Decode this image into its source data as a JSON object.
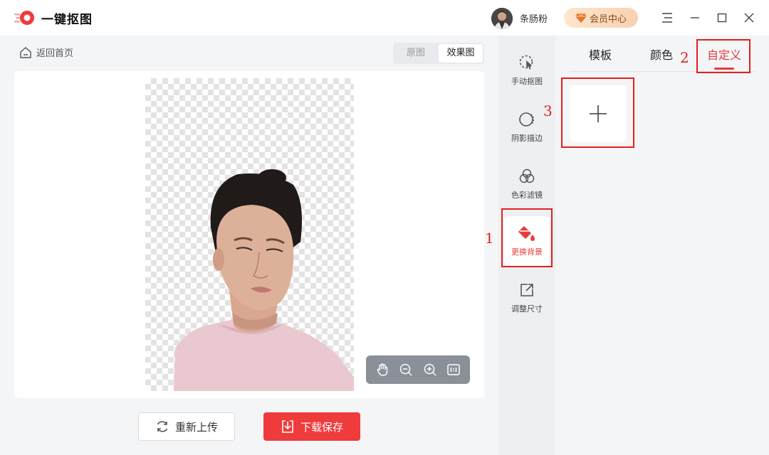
{
  "app": {
    "title": "一键抠图"
  },
  "user": {
    "name": "条肠粉"
  },
  "vip": {
    "label": "会员中心"
  },
  "nav": {
    "back_home": "返回首页"
  },
  "view_toggle": {
    "original": "原图",
    "effect": "效果图"
  },
  "tools": [
    {
      "label": "手动抠图",
      "icon": "cursor-select-icon"
    },
    {
      "label": "阴影描边",
      "icon": "shadow-outline-icon"
    },
    {
      "label": "色彩滤镜",
      "icon": "color-filter-icon"
    },
    {
      "label": "更换背景",
      "icon": "paint-bucket-icon",
      "active": true
    },
    {
      "label": "调整尺寸",
      "icon": "resize-icon"
    }
  ],
  "panel_tabs": {
    "template": "模板",
    "color": "颜色",
    "custom": "自定义"
  },
  "actions": {
    "reupload": "重新上传",
    "download": "下载保存"
  },
  "annotations": {
    "step1": "1",
    "step2": "2",
    "step3": "3"
  },
  "colors": {
    "accent": "#ef3b3b",
    "annotation": "#e02020"
  }
}
